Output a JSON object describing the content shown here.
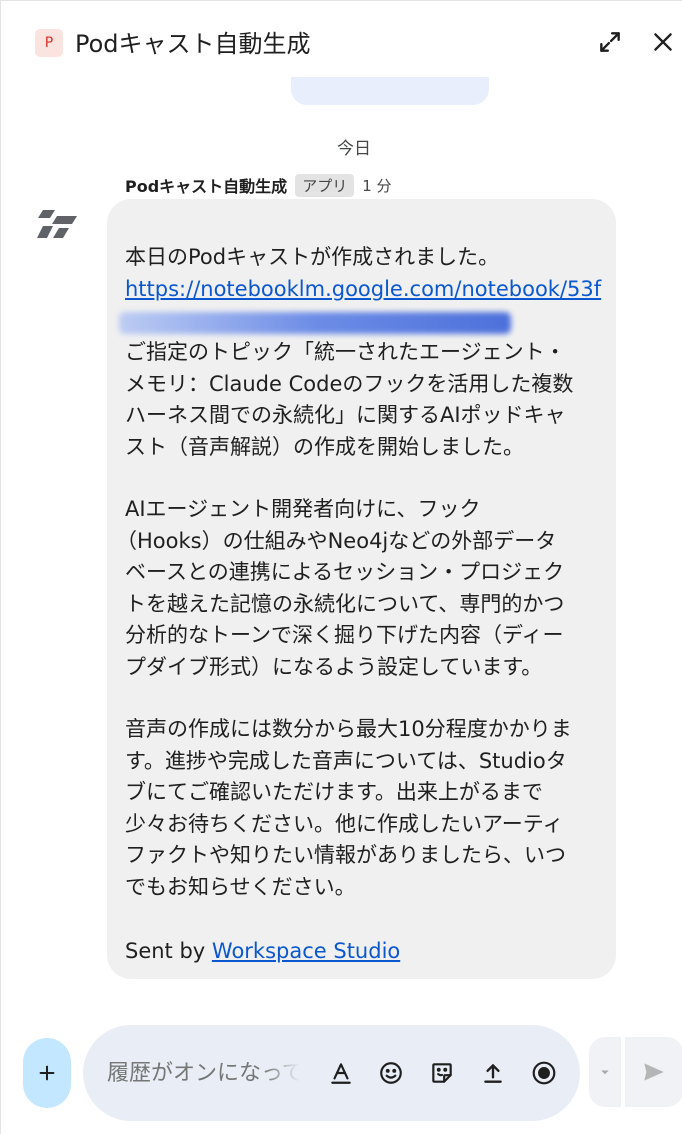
{
  "header": {
    "app_badge": "P",
    "title": "Podキャスト自動生成",
    "expand_icon": "expand-icon",
    "close_icon": "close-icon"
  },
  "date_separator": "今日",
  "message": {
    "sender": "Podキャスト自動生成",
    "sender_chip": "アプリ",
    "time": "1 分",
    "line_intro": "本日のPodキャストが作成されました。",
    "link_text": "https://notebooklm.google.com/notebook/53f",
    "para1": [
      "ご指定のトピック「統一されたエージェント・",
      "メモリ：Claude Codeのフックを活用した複数",
      "ハーネス間での永続化」に関するAIポッドキャ",
      "スト（音声解説）の作成を開始しました。"
    ],
    "para2": [
      "AIエージェント開発者向けに、フック",
      "（Hooks）の仕組みやNeo4jなどの外部データ",
      "ベースとの連携によるセッション・プロジェク",
      "トを越えた記憶の永続化について、専門的かつ",
      "分析的なトーンで深く掘り下げた内容（ディー",
      "プダイブ形式）になるよう設定しています。"
    ],
    "para3": [
      "音声の作成には数分から最大10分程度かかりま",
      "す。進捗や完成した音声については、Studioタ",
      "ブにてご確認いただけます。出来上がるまで",
      "少々お待ちください。他に作成したいアーティ",
      "ファクトや知りたい情報がありましたら、いつ",
      "でもお知らせください。"
    ],
    "sent_by_prefix": "Sent by ",
    "sent_by_link": "Workspace Studio"
  },
  "composer": {
    "placeholder": "履歴がオンになっています",
    "add_label": "+"
  },
  "colors": {
    "accent_link": "#0b57d0",
    "bubble_bg": "#f0f0f0",
    "composer_bg": "#e9eef6",
    "add_button_bg": "#c2e7ff"
  }
}
